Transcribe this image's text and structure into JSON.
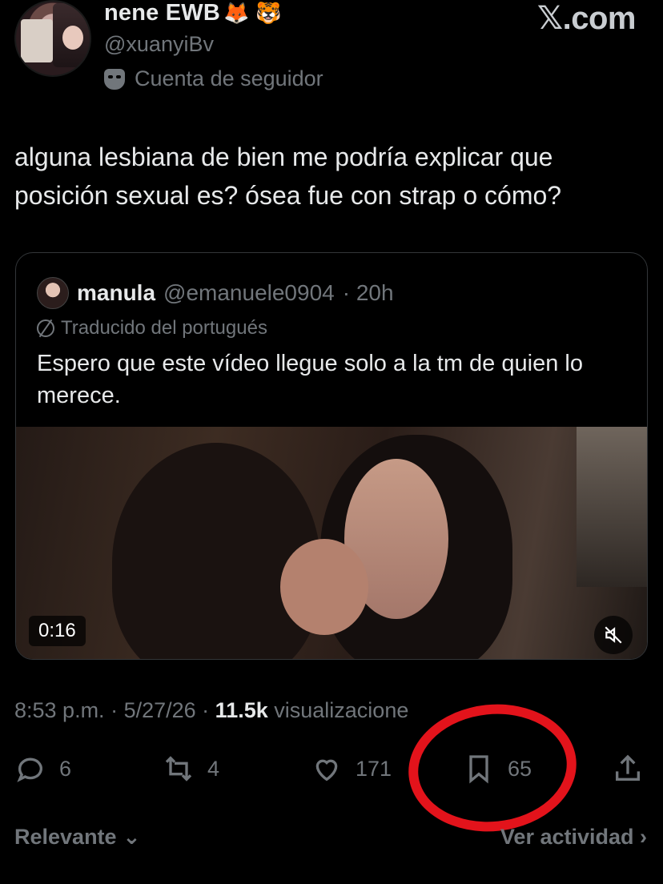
{
  "author": {
    "display_name": "nene EWB",
    "emojis": "🦊 🐯",
    "handle": "@xuanyiBv",
    "follower_label": "Cuenta de seguidor"
  },
  "watermark": "𝕏.com",
  "tweet": {
    "text": "alguna lesbiana de bien me podría explicar que posición sexual es? ósea fue con strap o cómo?"
  },
  "quote": {
    "name": "manula",
    "handle": "@emanuele0904",
    "time": "· 20h",
    "translated_label": "Traducido del portugués",
    "text": "Espero que este vídeo llegue solo a la tm de quien lo merece.",
    "video_duration": "0:16"
  },
  "meta": {
    "time": "8:53 p.m.",
    "date": "· 5/27/26 ·",
    "views_count": "11.5k",
    "views_label": "visualizacione"
  },
  "actions": {
    "replies": "6",
    "reposts": "4",
    "likes": "171",
    "bookmarks": "65"
  },
  "bottom": {
    "sort_label": "Relevante ⌄",
    "activity_label": "Ver actividad ›"
  },
  "colors": {
    "background": "#000000",
    "text": "#e7e9ea",
    "secondary": "#71767b",
    "annotation": "#e3131b"
  }
}
